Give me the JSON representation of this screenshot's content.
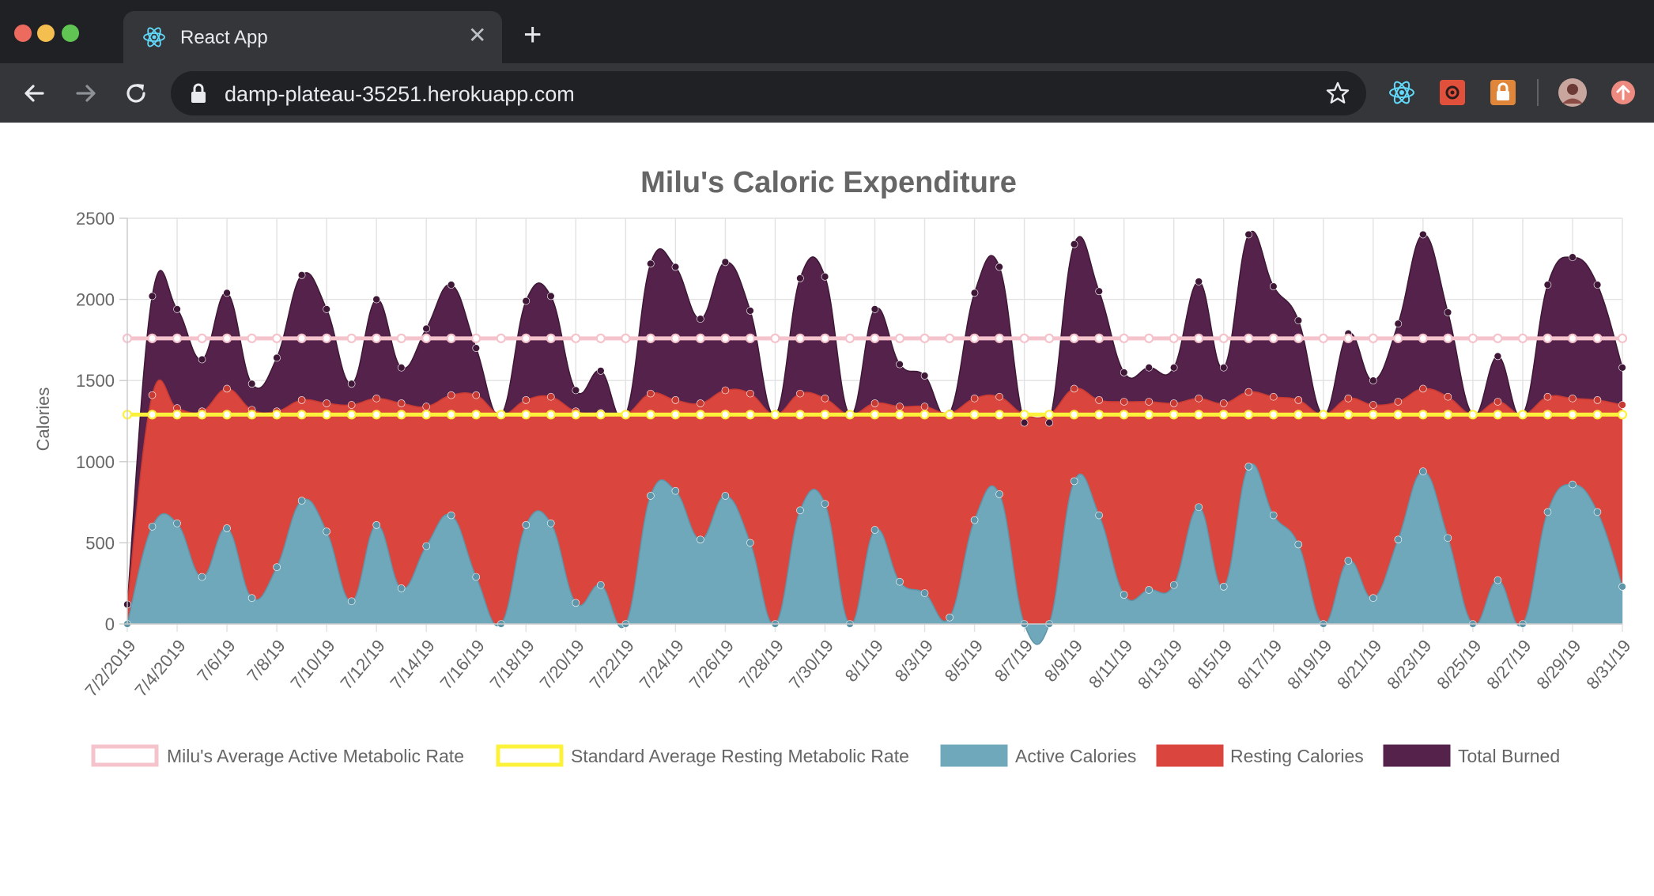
{
  "browser": {
    "tab_title": "React App",
    "tab_close": "✕",
    "new_tab": "+",
    "url": "damp-plateau-35251.herokuapp.com",
    "icons": [
      "back-arrow-icon",
      "forward-arrow-icon",
      "reload-icon",
      "lock-icon",
      "bookmark-star-icon",
      "react-devtools-icon",
      "redux-devtools-icon",
      "password-lock-extension-icon",
      "profile-avatar",
      "update-icon"
    ]
  },
  "colors": {
    "active_rate": "#f4c3cc",
    "resting_rate": "#fdf23b",
    "active": "#70a8bb",
    "resting": "#da453d",
    "total": "#54224a"
  },
  "chart_data": {
    "type": "area",
    "title": "Milu's Caloric Expenditure",
    "ylabel": "Calories",
    "xlabel": "",
    "ylim": [
      0,
      2500
    ],
    "yticks": [
      0,
      500,
      1000,
      1500,
      2000,
      2500
    ],
    "grid": true,
    "legend_position": "bottom",
    "x": [
      "7/2/2019",
      "7/3/19",
      "7/4/2019",
      "7/5/19",
      "7/6/19",
      "7/7/19",
      "7/8/19",
      "7/9/19",
      "7/10/19",
      "7/11/19",
      "7/12/19",
      "7/13/19",
      "7/14/19",
      "7/15/19",
      "7/16/19",
      "7/17/19",
      "7/18/19",
      "7/19/19",
      "7/20/19",
      "7/21/19",
      "7/22/19",
      "7/23/19",
      "7/24/19",
      "7/25/19",
      "7/26/19",
      "7/27/19",
      "7/28/19",
      "7/29/19",
      "7/30/19",
      "7/31/19",
      "8/1/19",
      "8/2/19",
      "8/3/19",
      "8/4/19",
      "8/5/19",
      "8/6/19",
      "8/7/19",
      "8/8/19",
      "8/9/19",
      "8/10/19",
      "8/11/19",
      "8/12/19",
      "8/13/19",
      "8/14/19",
      "8/15/19",
      "8/16/19",
      "8/17/19",
      "8/18/19",
      "8/19/19",
      "8/20/19",
      "8/21/19",
      "8/22/19",
      "8/23/19",
      "8/24/19",
      "8/25/19",
      "8/26/19",
      "8/27/19",
      "8/28/19",
      "8/29/19",
      "8/30/19",
      "8/31/19"
    ],
    "x_tick_labels": [
      "7/2/2019",
      "7/4/2019",
      "7/6/19",
      "7/8/19",
      "7/10/19",
      "7/12/19",
      "7/14/19",
      "7/16/19",
      "7/18/19",
      "7/20/19",
      "7/22/19",
      "7/24/19",
      "7/26/19",
      "7/28/19",
      "7/30/19",
      "8/1/19",
      "8/3/19",
      "8/5/19",
      "8/7/19",
      "8/9/19",
      "8/11/19",
      "8/13/19",
      "8/15/19",
      "8/17/19",
      "8/19/19",
      "8/21/19",
      "8/23/19",
      "8/25/19",
      "8/27/19",
      "8/29/19",
      "8/31/19"
    ],
    "series": [
      {
        "name": "Milu's Average Active Metabolic Rate",
        "kind": "line",
        "values": [
          1760,
          1760,
          1760,
          1760,
          1760,
          1760,
          1760,
          1760,
          1760,
          1760,
          1760,
          1760,
          1760,
          1760,
          1760,
          1760,
          1760,
          1760,
          1760,
          1760,
          1760,
          1760,
          1760,
          1760,
          1760,
          1760,
          1760,
          1760,
          1760,
          1760,
          1760,
          1760,
          1760,
          1760,
          1760,
          1760,
          1760,
          1760,
          1760,
          1760,
          1760,
          1760,
          1760,
          1760,
          1760,
          1760,
          1760,
          1760,
          1760,
          1760,
          1760,
          1760,
          1760,
          1760,
          1760,
          1760,
          1760,
          1760,
          1760,
          1760,
          1760
        ]
      },
      {
        "name": "Standard Average Resting Metabolic Rate",
        "kind": "line",
        "values": [
          1290,
          1290,
          1290,
          1290,
          1290,
          1290,
          1290,
          1290,
          1290,
          1290,
          1290,
          1290,
          1290,
          1290,
          1290,
          1290,
          1290,
          1290,
          1290,
          1290,
          1290,
          1290,
          1290,
          1290,
          1290,
          1290,
          1290,
          1290,
          1290,
          1290,
          1290,
          1290,
          1290,
          1290,
          1290,
          1290,
          1290,
          1290,
          1290,
          1290,
          1290,
          1290,
          1290,
          1290,
          1290,
          1290,
          1290,
          1290,
          1290,
          1290,
          1290,
          1290,
          1290,
          1290,
          1290,
          1290,
          1290,
          1290,
          1290,
          1290,
          1290
        ]
      },
      {
        "name": "Active Calories",
        "kind": "area",
        "values": [
          0,
          600,
          620,
          290,
          590,
          160,
          350,
          760,
          570,
          140,
          610,
          220,
          480,
          670,
          290,
          0,
          610,
          620,
          130,
          240,
          0,
          790,
          820,
          520,
          790,
          500,
          0,
          700,
          740,
          0,
          580,
          260,
          190,
          40,
          640,
          800,
          0,
          0,
          880,
          670,
          180,
          210,
          240,
          720,
          230,
          970,
          670,
          490,
          0,
          390,
          160,
          520,
          940,
          530,
          0,
          270,
          0,
          690,
          860,
          690,
          230
        ]
      },
      {
        "name": "Resting Calories",
        "kind": "area",
        "values": [
          120,
          1410,
          1330,
          1310,
          1450,
          1320,
          1310,
          1380,
          1360,
          1350,
          1390,
          1360,
          1340,
          1410,
          1410,
          1290,
          1380,
          1400,
          1310,
          1300,
          1290,
          1420,
          1380,
          1360,
          1440,
          1420,
          1290,
          1420,
          1390,
          1290,
          1360,
          1340,
          1340,
          1300,
          1390,
          1400,
          1290,
          1290,
          1450,
          1380,
          1370,
          1370,
          1360,
          1390,
          1360,
          1430,
          1400,
          1380,
          1290,
          1390,
          1350,
          1370,
          1450,
          1400,
          1290,
          1370,
          1290,
          1400,
          1390,
          1380,
          1350
        ]
      },
      {
        "name": "Total Burned",
        "kind": "area",
        "values": [
          120,
          2020,
          1940,
          1630,
          2040,
          1480,
          1640,
          2150,
          1940,
          1480,
          2000,
          1580,
          1820,
          2090,
          1700,
          1290,
          1990,
          2020,
          1440,
          1560,
          1290,
          2220,
          2200,
          1880,
          2230,
          1930,
          1290,
          2130,
          2140,
          1290,
          1940,
          1600,
          1530,
          1300,
          2040,
          2200,
          1240,
          1240,
          2340,
          2050,
          1550,
          1580,
          1580,
          2110,
          1580,
          2400,
          2080,
          1870,
          1290,
          1790,
          1500,
          1850,
          2400,
          1920,
          1290,
          1650,
          1290,
          2090,
          2260,
          2090,
          1580
        ]
      }
    ]
  }
}
